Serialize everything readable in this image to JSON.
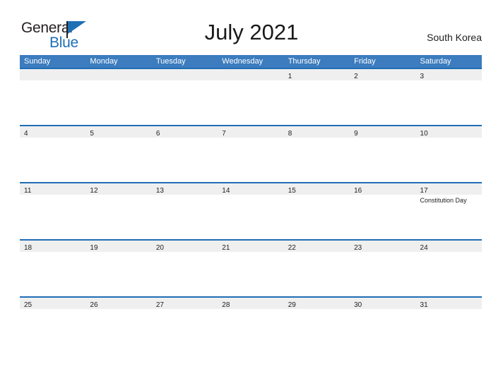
{
  "header": {
    "logo": {
      "text_primary": "General",
      "text_secondary": "Blue",
      "flag_color": "#1f6fb5",
      "primary_color": "#231f20"
    },
    "title": "July 2021",
    "country": "South Korea"
  },
  "theme": {
    "header_blue": "#3c7cbf",
    "row_border_blue": "#1f6eb5",
    "date_band_gray": "#efefef",
    "text_dark": "#222222",
    "background": "#ffffff"
  },
  "calendar": {
    "day_names": [
      "Sunday",
      "Monday",
      "Tuesday",
      "Wednesday",
      "Thursday",
      "Friday",
      "Saturday"
    ],
    "weeks": [
      [
        {
          "date": "",
          "events": []
        },
        {
          "date": "",
          "events": []
        },
        {
          "date": "",
          "events": []
        },
        {
          "date": "",
          "events": []
        },
        {
          "date": "1",
          "events": []
        },
        {
          "date": "2",
          "events": []
        },
        {
          "date": "3",
          "events": []
        }
      ],
      [
        {
          "date": "4",
          "events": []
        },
        {
          "date": "5",
          "events": []
        },
        {
          "date": "6",
          "events": []
        },
        {
          "date": "7",
          "events": []
        },
        {
          "date": "8",
          "events": []
        },
        {
          "date": "9",
          "events": []
        },
        {
          "date": "10",
          "events": []
        }
      ],
      [
        {
          "date": "11",
          "events": []
        },
        {
          "date": "12",
          "events": []
        },
        {
          "date": "13",
          "events": []
        },
        {
          "date": "14",
          "events": []
        },
        {
          "date": "15",
          "events": []
        },
        {
          "date": "16",
          "events": []
        },
        {
          "date": "17",
          "events": [
            "Constitution Day"
          ]
        }
      ],
      [
        {
          "date": "18",
          "events": []
        },
        {
          "date": "19",
          "events": []
        },
        {
          "date": "20",
          "events": []
        },
        {
          "date": "21",
          "events": []
        },
        {
          "date": "22",
          "events": []
        },
        {
          "date": "23",
          "events": []
        },
        {
          "date": "24",
          "events": []
        }
      ],
      [
        {
          "date": "25",
          "events": []
        },
        {
          "date": "26",
          "events": []
        },
        {
          "date": "27",
          "events": []
        },
        {
          "date": "28",
          "events": []
        },
        {
          "date": "29",
          "events": []
        },
        {
          "date": "30",
          "events": []
        },
        {
          "date": "31",
          "events": []
        }
      ]
    ]
  }
}
